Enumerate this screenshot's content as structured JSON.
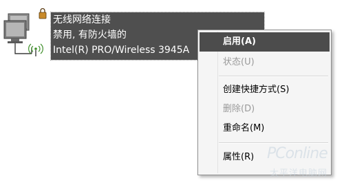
{
  "network_connection": {
    "name": "无线网络连接",
    "status": "禁用, 有防火墙的",
    "adapter": "Intel(R) PRO/Wireless 3945A"
  },
  "context_menu": {
    "items": [
      {
        "label": "启用(A)",
        "state": "default-highlighted"
      },
      {
        "label": "状态(U)",
        "state": "disabled"
      },
      {
        "label": "创建快捷方式(S)",
        "state": "enabled"
      },
      {
        "label": "删除(D)",
        "state": "disabled"
      },
      {
        "label": "重命名(M)",
        "state": "enabled"
      },
      {
        "label": "属性(R)",
        "state": "enabled"
      }
    ]
  },
  "watermark": {
    "brand": "PConline",
    "sub": "太平洋电脑网"
  },
  "colors": {
    "selection": "#4f4f4f",
    "menu_highlight": "#4c4c4c",
    "menu_background": "#f5f5f5",
    "disabled_text": "#9a9a9a"
  }
}
